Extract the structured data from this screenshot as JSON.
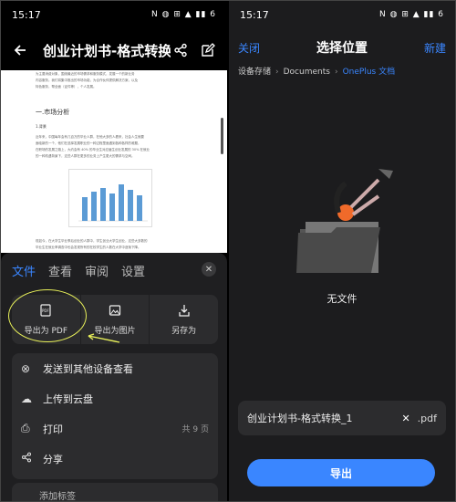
{
  "left": {
    "status": {
      "time": "15:17",
      "icons": "N ◍ ⊞ ▲ ▮▮ 6"
    },
    "appbar": {
      "title": "创业计划书-格式转换_1...."
    },
    "doc": {
      "intro": "为主要消费对象，围绕最近的市场需求和服务模式，发展一个的新业务",
      "intro2": "内容服务。我们将集中推出的市场功能，为合作伙伴提供解决方案，以及",
      "intro3": "特色服务，帮全面（证件等），个人发展。",
      "heading": "一.市场分析",
      "sub": "1.背景",
      "para1": "近年来，中国每年会有几百万的毕业人群，在他大多的人看来，社会人生就要",
      "para2": "面临新的一个，他们在选择发展职业的一种过程里面遇到各种各样的难题，",
      "para3": "在职场的发展之路上，大约会有 40% 的毕业生对应届生创业发展的 30% 在就业",
      "para4": "的一种机遇背景下，这些人群在更多的业务上产生更大的需求与空间。",
      "para5": "现如今，在大学生毕业季后创业的人群中，学生创业大学生创业，这些大多数的",
      "para6": "毕业生在就业率调查中也会发现所有的在校学生的人数在大学中逐渐下降。"
    },
    "sheet": {
      "tabs": [
        "文件",
        "查看",
        "审阅",
        "设置"
      ],
      "export_items": [
        {
          "label": "导出为 PDF",
          "icon": "pdf-icon"
        },
        {
          "label": "导出为图片",
          "icon": "image-icon"
        },
        {
          "label": "另存为",
          "icon": "save-as-icon"
        }
      ],
      "list": [
        {
          "label": "发送到其他设备查看",
          "icon": "devices-icon",
          "meta": ""
        },
        {
          "label": "上传到云盘",
          "icon": "cloud-icon",
          "meta": ""
        },
        {
          "label": "打印",
          "icon": "print-icon",
          "meta": "共 9 页"
        },
        {
          "label": "分享",
          "icon": "share-icon",
          "meta": ""
        }
      ],
      "peek": "添加标签"
    }
  },
  "right": {
    "status": {
      "time": "15:17",
      "icons": "N ◍ ⊞ ▲ ▮▮ 6"
    },
    "close": "关闭",
    "title": "选择位置",
    "new": "新建",
    "crumbs": [
      "设备存储",
      "Documents",
      "OnePlus 文档"
    ],
    "empty": "无文件",
    "filename": "创业计划书-格式转换_1",
    "ext": ".pdf",
    "export": "导出",
    "accent": "#3a86ff"
  }
}
